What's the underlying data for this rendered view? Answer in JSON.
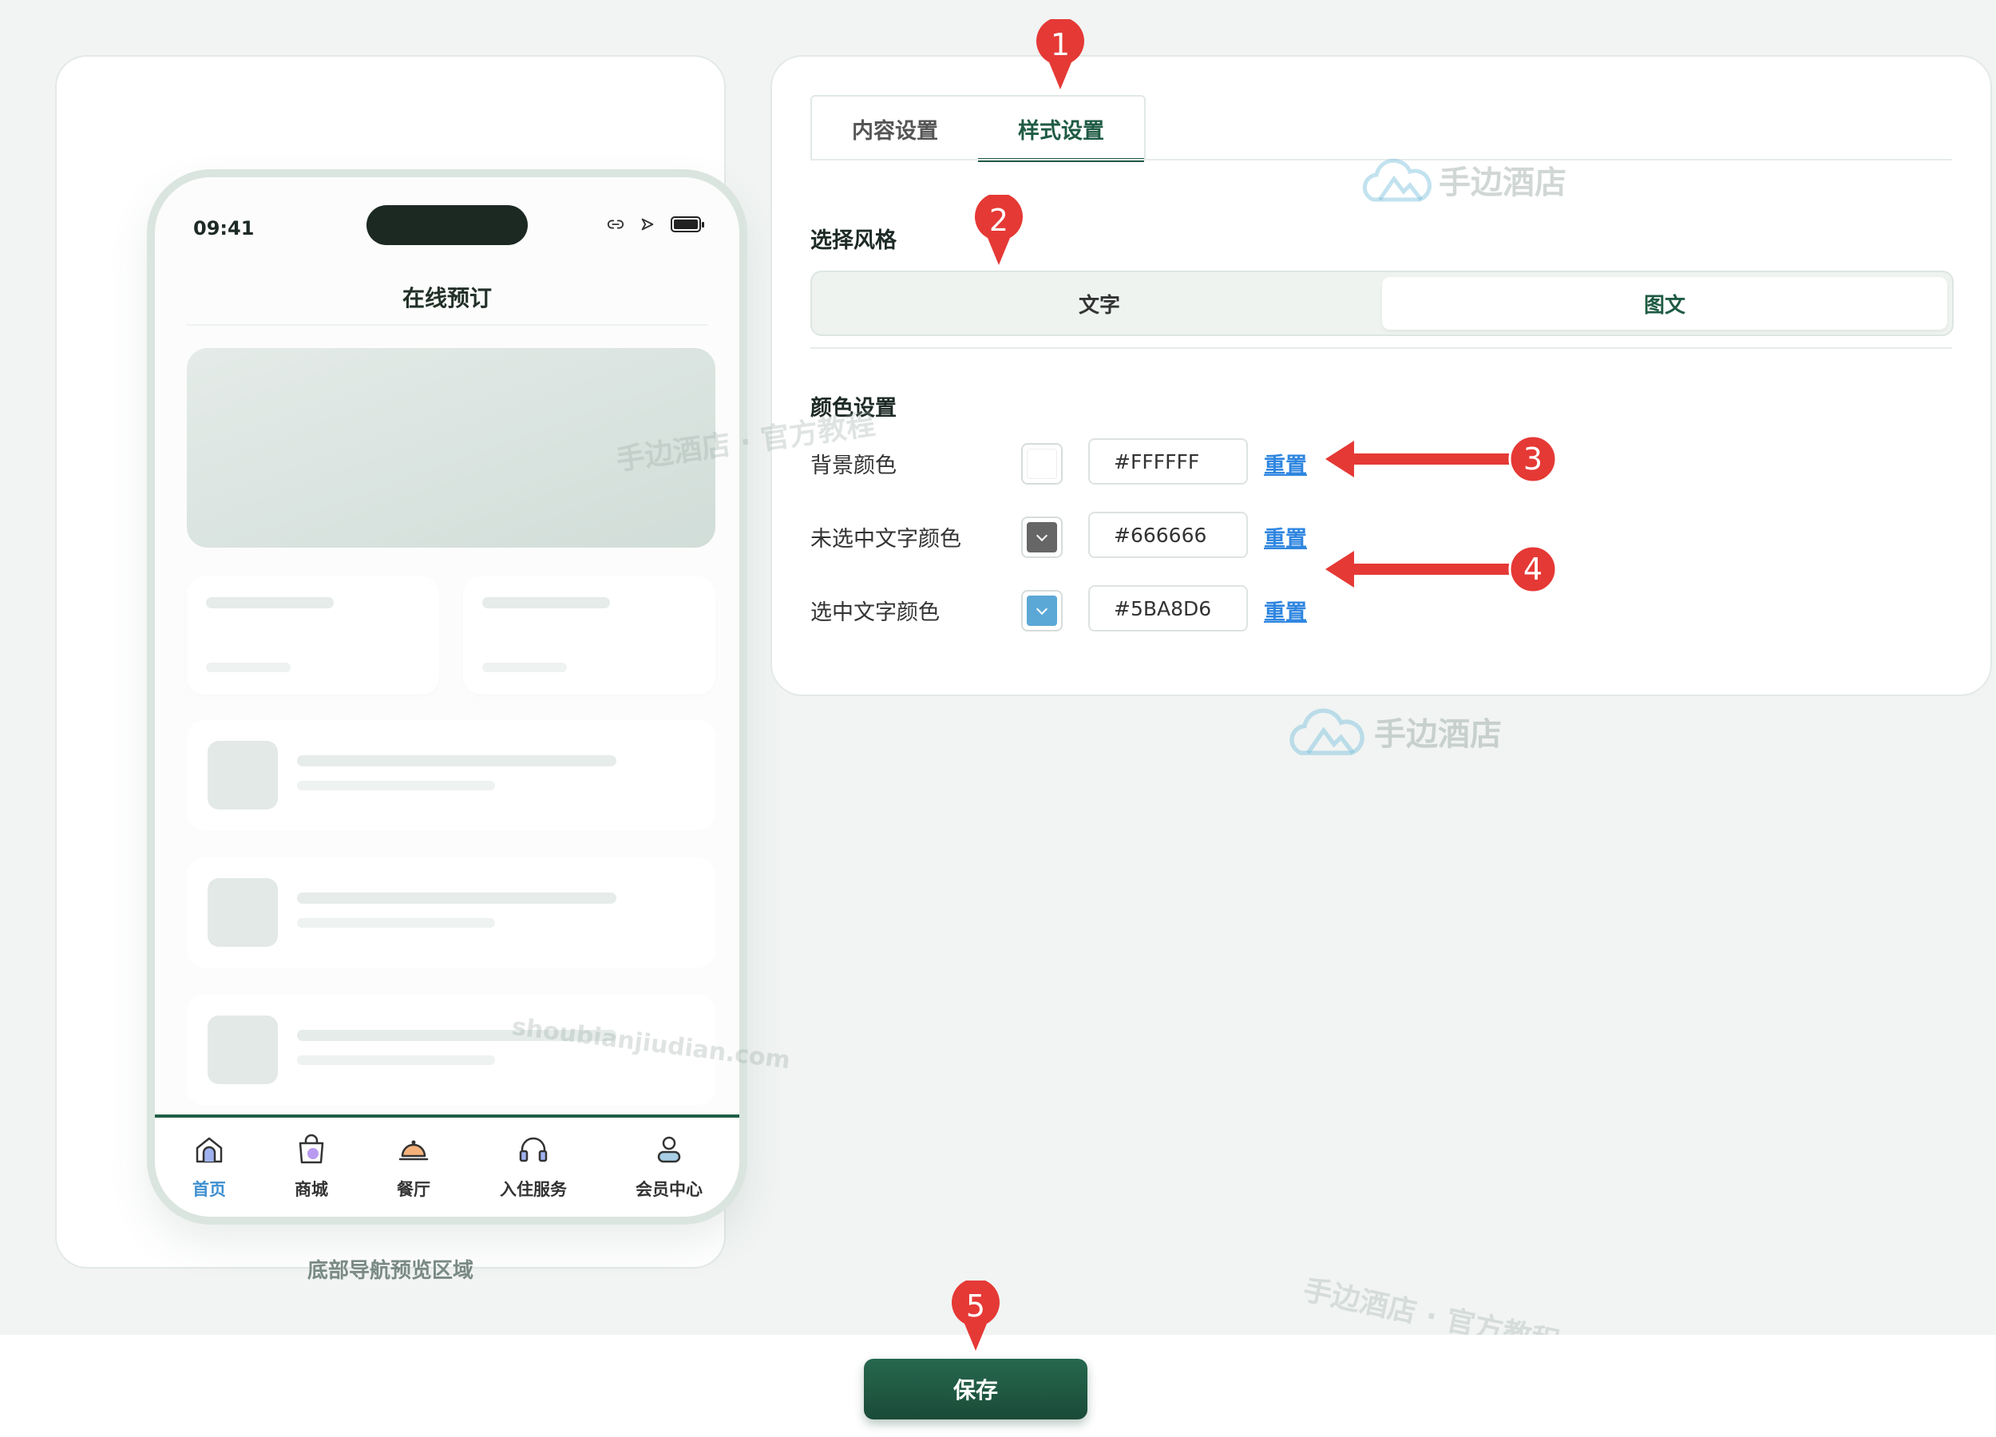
{
  "preview": {
    "status_time": "09:41",
    "title": "在线预订",
    "caption": "底部导航预览区域",
    "tabbar": [
      {
        "label": "首页",
        "icon": "home-icon",
        "active": true
      },
      {
        "label": "商城",
        "icon": "shopping-bag-icon",
        "active": false
      },
      {
        "label": "餐厅",
        "icon": "service-bell-icon",
        "active": false
      },
      {
        "label": "入住服务",
        "icon": "headset-icon",
        "active": false
      },
      {
        "label": "会员中心",
        "icon": "user-icon",
        "active": false
      }
    ]
  },
  "settings": {
    "tabs": [
      {
        "label": "内容设置",
        "active": false
      },
      {
        "label": "样式设置",
        "active": true
      }
    ],
    "style_section_label": "选择风格",
    "style_options": [
      {
        "label": "文字",
        "active": false
      },
      {
        "label": "图文",
        "active": true
      }
    ],
    "color_section_label": "颜色设置",
    "colors": [
      {
        "label": "背景颜色",
        "value": "#FFFFFF",
        "swatch": "#FFFFFF",
        "reset": "重置"
      },
      {
        "label": "未选中文字颜色",
        "value": "#666666",
        "swatch": "#666666",
        "reset": "重置"
      },
      {
        "label": "选中文字颜色",
        "value": "#5BA8D6",
        "swatch": "#5BA8D6",
        "reset": "重置"
      }
    ]
  },
  "save_label": "保存",
  "watermarks": {
    "brand": "手边酒店",
    "tagline": "手边酒店 · 官方教程",
    "domain": "shoubianjiudian.com"
  },
  "annotations": [
    "1",
    "2",
    "3",
    "4",
    "5"
  ],
  "colors": {
    "primary": "#1F5B44",
    "link": "#2F86E0",
    "marker": "#E53935",
    "active_tab_text": "#3E8FD0"
  }
}
